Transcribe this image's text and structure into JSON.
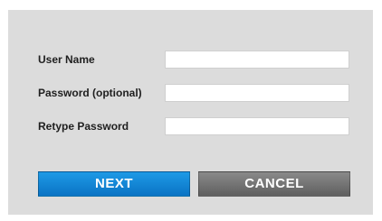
{
  "form": {
    "fields": [
      {
        "label": "User Name",
        "value": "",
        "placeholder": ""
      },
      {
        "label": "Password (optional)",
        "value": "",
        "placeholder": ""
      },
      {
        "label": "Retype Password",
        "value": "",
        "placeholder": ""
      }
    ],
    "next_label": "NEXT",
    "cancel_label": "CANCEL"
  },
  "colors": {
    "panel_background": "#dcdcdc",
    "next_button": "#0f85d6",
    "cancel_button": "#747474"
  }
}
